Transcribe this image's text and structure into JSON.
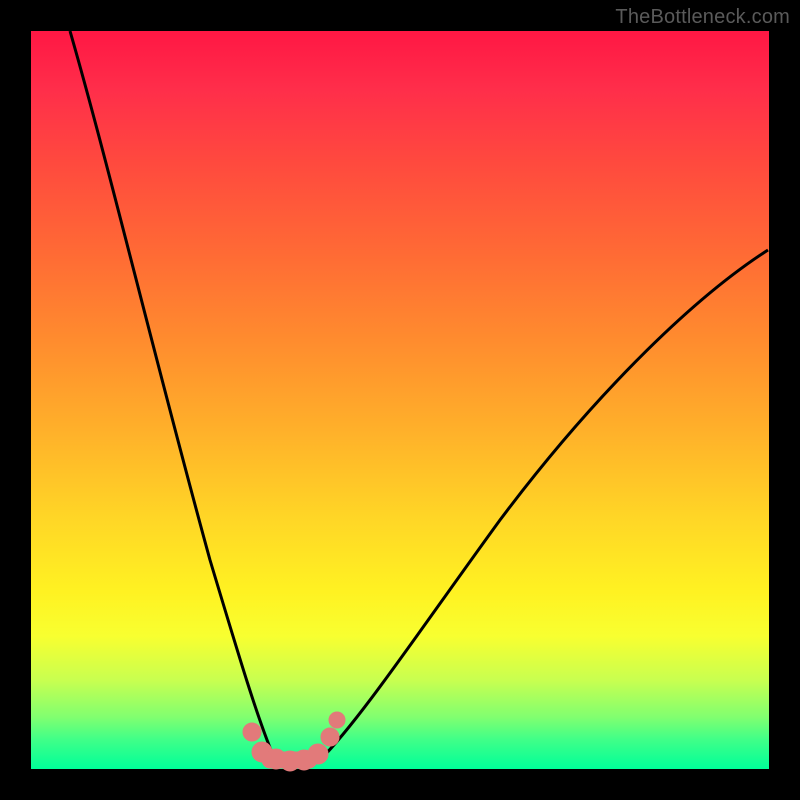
{
  "watermark": "TheBottleneck.com",
  "chart_data": {
    "type": "line",
    "title": "",
    "xlabel": "",
    "ylabel": "",
    "xlim": [
      0,
      100
    ],
    "ylim": [
      0,
      100
    ],
    "grid": false,
    "background_gradient": {
      "top": "#ff1744",
      "middle": "#fff222",
      "bottom": "#00ff99"
    },
    "description": "Bottleneck curve: V-shaped black curve over a red-to-green vertical gradient. Minimum (optimal match) occurs near x≈32 where y≈0. A cluster of salmon-pink markers highlights the trough region.",
    "series": [
      {
        "name": "curve",
        "color": "#000000",
        "x": [
          5,
          8,
          11,
          14,
          17,
          20,
          23,
          26,
          29,
          31,
          33,
          35,
          38,
          42,
          47,
          53,
          60,
          68,
          76,
          84,
          92,
          100
        ],
        "y": [
          100,
          86,
          72,
          59,
          47,
          36,
          26,
          17,
          8,
          2,
          0,
          2,
          7,
          14,
          22,
          30,
          38,
          46,
          53,
          59,
          65,
          70
        ]
      },
      {
        "name": "trough-markers",
        "color": "#e27a7a",
        "type": "scatter",
        "x": [
          27.5,
          29.0,
          30.5,
          32.0,
          33.5,
          35.5,
          36.5,
          37.3
        ],
        "y": [
          5.0,
          1.5,
          1.0,
          1.0,
          1.0,
          2.5,
          4.8,
          7.0
        ]
      }
    ]
  }
}
